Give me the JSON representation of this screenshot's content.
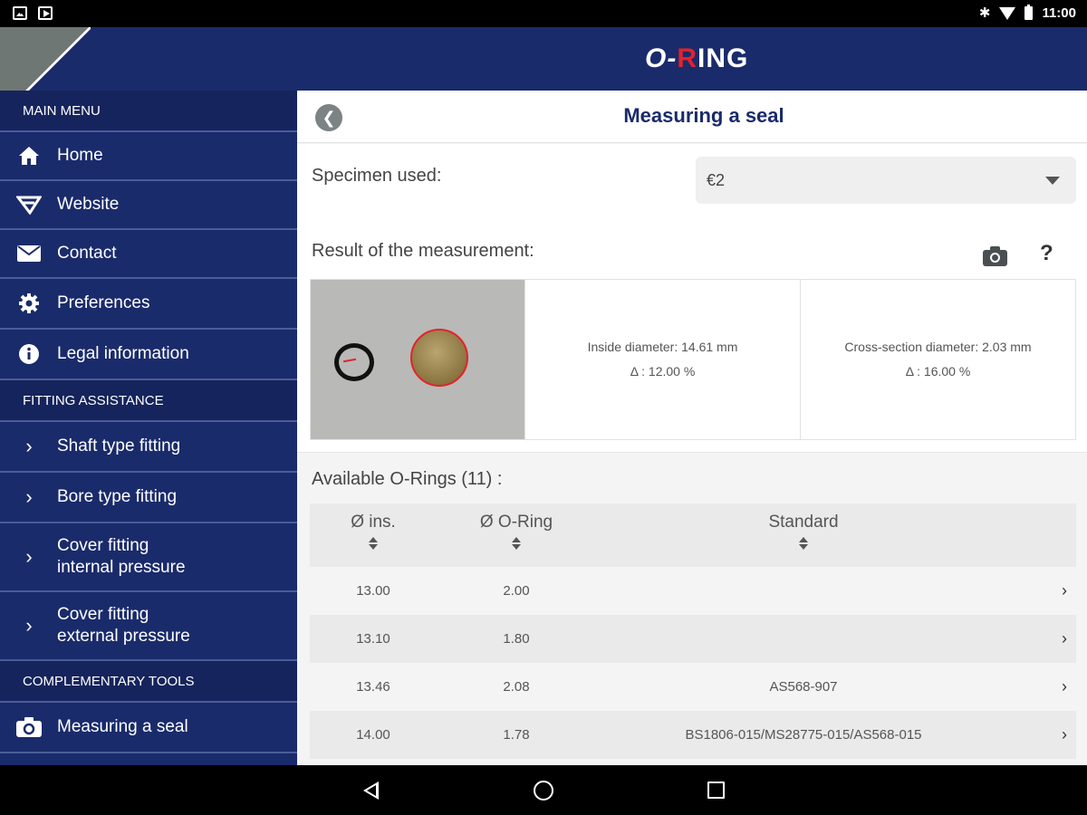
{
  "status_bar": {
    "time": "11:00"
  },
  "header": {
    "logo_o": "O-",
    "logo_r": "R",
    "logo_rest": "ING"
  },
  "sidebar": {
    "sections": [
      {
        "title": "Main menu"
      },
      {
        "title": "Fitting assistance"
      },
      {
        "title": "Complementary tools"
      }
    ],
    "main_items": [
      {
        "label": "Home",
        "icon": "home-icon"
      },
      {
        "label": "Website",
        "icon": "website-icon"
      },
      {
        "label": "Contact",
        "icon": "envelope-icon"
      },
      {
        "label": "Preferences",
        "icon": "gear-icon"
      },
      {
        "label": "Legal information",
        "icon": "info-icon"
      }
    ],
    "fitting_items": [
      {
        "label": "Shaft type fitting"
      },
      {
        "label": "Bore type fitting"
      },
      {
        "label_line1": "Cover fitting",
        "label_line2": "internal pressure"
      },
      {
        "label_line1": "Cover fitting",
        "label_line2": "external pressure"
      }
    ],
    "tools_items": [
      {
        "label": "Measuring a seal",
        "icon": "camera-icon"
      }
    ]
  },
  "page": {
    "title": "Measuring a seal",
    "specimen_label": "Specimen used:",
    "specimen_value": "€2",
    "result_label": "Result of the measurement:",
    "help_label": "?",
    "inside": {
      "line1": "Inside diameter: 14.61 mm",
      "line2": "Δ : 12.00 %"
    },
    "cross": {
      "line1": "Cross-section diameter: 2.03 mm",
      "line2": "Δ : 16.00 %"
    },
    "available_label": "Available O-Rings (11) :",
    "table": {
      "headers": [
        "Ø ins.",
        "Ø O-Ring",
        "Standard"
      ],
      "rows": [
        {
          "ins": "13.00",
          "oring": "2.00",
          "standard": ""
        },
        {
          "ins": "13.10",
          "oring": "1.80",
          "standard": ""
        },
        {
          "ins": "13.46",
          "oring": "2.08",
          "standard": "AS568-907"
        },
        {
          "ins": "14.00",
          "oring": "1.78",
          "standard": "BS1806-015/MS28775-015/AS568-015"
        }
      ]
    }
  },
  "colors": {
    "navy": "#1a2b6b",
    "accent_red": "#e3222b"
  }
}
